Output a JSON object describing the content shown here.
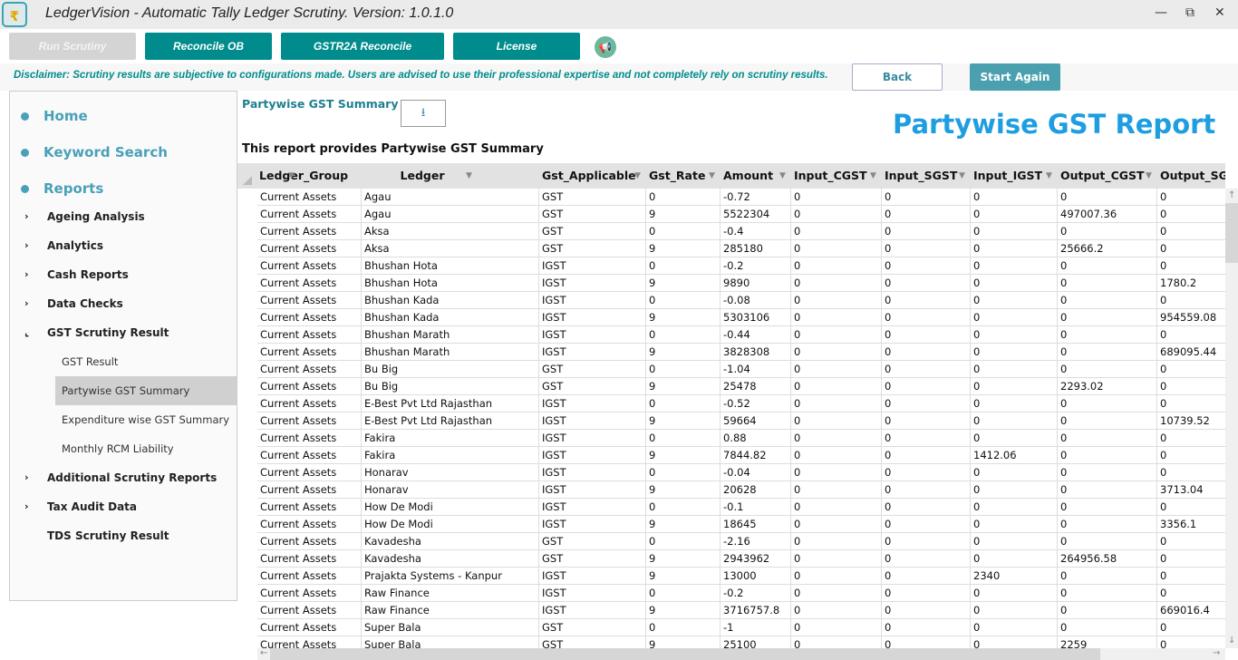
{
  "window": {
    "title": "LedgerVision - Automatic Tally Ledger Scrutiny.  Version: 1.0.1.0",
    "logo_glyph": "₹",
    "minimize": "—",
    "restore": "⧉",
    "close": "✕"
  },
  "toolbar": {
    "run_scrutiny": "Run Scrutiny",
    "reconcile_ob": "Reconcile OB",
    "gstr2a": "GSTR2A Reconcile",
    "license": "License",
    "announce_icon": "megaphone-icon"
  },
  "disclaimer": "Disclaimer: Scrutiny results are subjective to configurations made. Users are advised to use their professional expertise and not completely rely on scrutiny results.",
  "actions": {
    "back": "Back",
    "start_again": "Start Again"
  },
  "sidebar": {
    "main": [
      {
        "label": "Home"
      },
      {
        "label": "Keyword Search"
      },
      {
        "label": "Reports"
      }
    ],
    "reports": [
      {
        "label": "Ageing Analysis",
        "chev": "›"
      },
      {
        "label": "Analytics",
        "chev": "›"
      },
      {
        "label": "Cash Reports",
        "chev": "›"
      },
      {
        "label": "Data Checks",
        "chev": "›"
      },
      {
        "label": "GST Scrutiny Result",
        "chev": "⌞"
      }
    ],
    "gst_sub": [
      {
        "label": "GST Result"
      },
      {
        "label": "Partywise GST Summary",
        "selected": true
      },
      {
        "label": "Expenditure wise GST Summary"
      },
      {
        "label": "Monthly RCM Liability"
      }
    ],
    "more": [
      {
        "label": "Additional Scrutiny Reports",
        "chev": "›"
      },
      {
        "label": "Tax Audit Data",
        "chev": "›"
      },
      {
        "label": "TDS Scrutiny Result",
        "chev": ""
      }
    ]
  },
  "report": {
    "section_title": "Partywise GST Summary",
    "download_icon": "⭳",
    "big_title": "Partywise GST Report",
    "description": "This report provides Partywise GST Summary"
  },
  "table": {
    "columns": [
      "Ledger_Group",
      "Ledger",
      "Gst_Applicable",
      "Gst_Rate",
      "Amount",
      "Input_CGST",
      "Input_SGST",
      "Input_IGST",
      "Output_CGST",
      "Output_SGST"
    ],
    "rows": [
      [
        "Current Assets",
        "Agau",
        "GST",
        "0",
        "-0.72",
        "0",
        "0",
        "0",
        "0",
        "0"
      ],
      [
        "Current Assets",
        "Agau",
        "GST",
        "9",
        "5522304",
        "0",
        "0",
        "0",
        "497007.36",
        "0"
      ],
      [
        "Current Assets",
        "Aksa",
        "GST",
        "0",
        "-0.4",
        "0",
        "0",
        "0",
        "0",
        "0"
      ],
      [
        "Current Assets",
        "Aksa",
        "GST",
        "9",
        "285180",
        "0",
        "0",
        "0",
        "25666.2",
        "0"
      ],
      [
        "Current Assets",
        "Bhushan Hota",
        "IGST",
        "0",
        "-0.2",
        "0",
        "0",
        "0",
        "0",
        "0"
      ],
      [
        "Current Assets",
        "Bhushan Hota",
        "IGST",
        "9",
        "9890",
        "0",
        "0",
        "0",
        "0",
        "1780.2"
      ],
      [
        "Current Assets",
        "Bhushan Kada",
        "IGST",
        "0",
        "-0.08",
        "0",
        "0",
        "0",
        "0",
        "0"
      ],
      [
        "Current Assets",
        "Bhushan Kada",
        "IGST",
        "9",
        "5303106",
        "0",
        "0",
        "0",
        "0",
        "954559.08"
      ],
      [
        "Current Assets",
        "Bhushan Marath",
        "IGST",
        "0",
        "-0.44",
        "0",
        "0",
        "0",
        "0",
        "0"
      ],
      [
        "Current Assets",
        "Bhushan Marath",
        "IGST",
        "9",
        "3828308",
        "0",
        "0",
        "0",
        "0",
        "689095.44"
      ],
      [
        "Current Assets",
        "Bu Big",
        "GST",
        "0",
        "-1.04",
        "0",
        "0",
        "0",
        "0",
        "0"
      ],
      [
        "Current Assets",
        "Bu Big",
        "GST",
        "9",
        "25478",
        "0",
        "0",
        "0",
        "2293.02",
        "0"
      ],
      [
        "Current Assets",
        "E-Best Pvt Ltd Rajasthan",
        "IGST",
        "0",
        "-0.52",
        "0",
        "0",
        "0",
        "0",
        "0"
      ],
      [
        "Current Assets",
        "E-Best Pvt Ltd Rajasthan",
        "IGST",
        "9",
        "59664",
        "0",
        "0",
        "0",
        "0",
        "10739.52"
      ],
      [
        "Current Assets",
        "Fakira",
        "IGST",
        "0",
        "0.88",
        "0",
        "0",
        "0",
        "0",
        "0"
      ],
      [
        "Current Assets",
        "Fakira",
        "IGST",
        "9",
        "7844.82",
        "0",
        "0",
        "1412.06",
        "0",
        "0"
      ],
      [
        "Current Assets",
        "Honarav",
        "IGST",
        "0",
        "-0.04",
        "0",
        "0",
        "0",
        "0",
        "0"
      ],
      [
        "Current Assets",
        "Honarav",
        "IGST",
        "9",
        "20628",
        "0",
        "0",
        "0",
        "0",
        "3713.04"
      ],
      [
        "Current Assets",
        "How De Modi",
        "IGST",
        "0",
        "-0.1",
        "0",
        "0",
        "0",
        "0",
        "0"
      ],
      [
        "Current Assets",
        "How De Modi",
        "IGST",
        "9",
        "18645",
        "0",
        "0",
        "0",
        "0",
        "3356.1"
      ],
      [
        "Current Assets",
        "Kavadesha",
        "GST",
        "0",
        "-2.16",
        "0",
        "0",
        "0",
        "0",
        "0"
      ],
      [
        "Current Assets",
        "Kavadesha",
        "GST",
        "9",
        "2943962",
        "0",
        "0",
        "0",
        "264956.58",
        "0"
      ],
      [
        "Current Assets",
        "Prajakta Systems - Kanpur",
        "IGST",
        "9",
        "13000",
        "0",
        "0",
        "2340",
        "0",
        "0"
      ],
      [
        "Current Assets",
        "Raw Finance",
        "IGST",
        "0",
        "-0.2",
        "0",
        "0",
        "0",
        "0",
        "0"
      ],
      [
        "Current Assets",
        "Raw Finance",
        "IGST",
        "9",
        "3716757.8",
        "0",
        "0",
        "0",
        "0",
        "669016.4"
      ],
      [
        "Current Assets",
        "Super Bala",
        "GST",
        "0",
        "-1",
        "0",
        "0",
        "0",
        "0",
        "0"
      ],
      [
        "Current Assets",
        "Super Bala",
        "GST",
        "9",
        "25100",
        "0",
        "0",
        "0",
        "2259",
        "0"
      ]
    ]
  },
  "colors": {
    "teal": "#008c8c",
    "accent": "#4aa0b8",
    "title_blue": "#1e9ee0"
  }
}
